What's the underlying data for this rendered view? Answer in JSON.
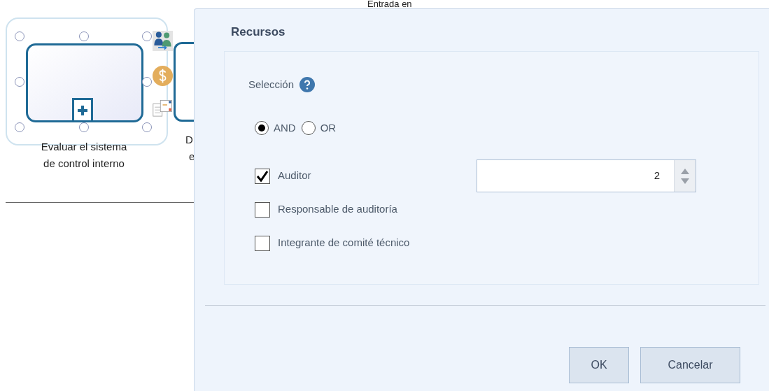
{
  "canvas": {
    "cut_label_top": "Entrada en",
    "task": {
      "label_lines": [
        "Evaluar el sistema",
        "de control interno"
      ],
      "selected": true
    },
    "next_task_label_lines": [
      "D",
      "e"
    ]
  },
  "dialog": {
    "title": "Recursos",
    "selection": {
      "label": "Selección",
      "options": [
        {
          "label": "AND",
          "selected": true
        },
        {
          "label": "OR",
          "selected": false
        }
      ]
    },
    "resources": [
      {
        "label": "Auditor",
        "checked": true,
        "quantity": "2"
      },
      {
        "label": "Responsable de auditoría",
        "checked": false
      },
      {
        "label": "Integrante de comité técnico",
        "checked": false
      }
    ],
    "buttons": [
      "OK",
      "Cancelar"
    ]
  }
}
